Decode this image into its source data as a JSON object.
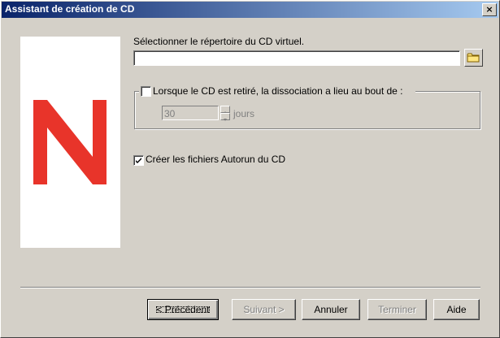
{
  "window": {
    "title": "Assistant de création de CD",
    "close_label": "×"
  },
  "directory": {
    "label": "Sélectionner le répertoire du CD virtuel.",
    "value": "",
    "browse_icon": "folder-icon"
  },
  "dissociation": {
    "label": "Lorsque le CD est retiré, la dissociation a lieu au bout de :",
    "checked": false,
    "days_value": "30",
    "days_unit": "jours"
  },
  "autorun": {
    "label": "Créer les fichiers Autorun du CD",
    "checked": true
  },
  "buttons": {
    "previous": "< Précédent",
    "next": "Suivant >",
    "cancel": "Annuler",
    "finish": "Terminer",
    "help": "Aide"
  },
  "colors": {
    "logo_red": "#e8342a",
    "titlebar": "#0a246a"
  }
}
